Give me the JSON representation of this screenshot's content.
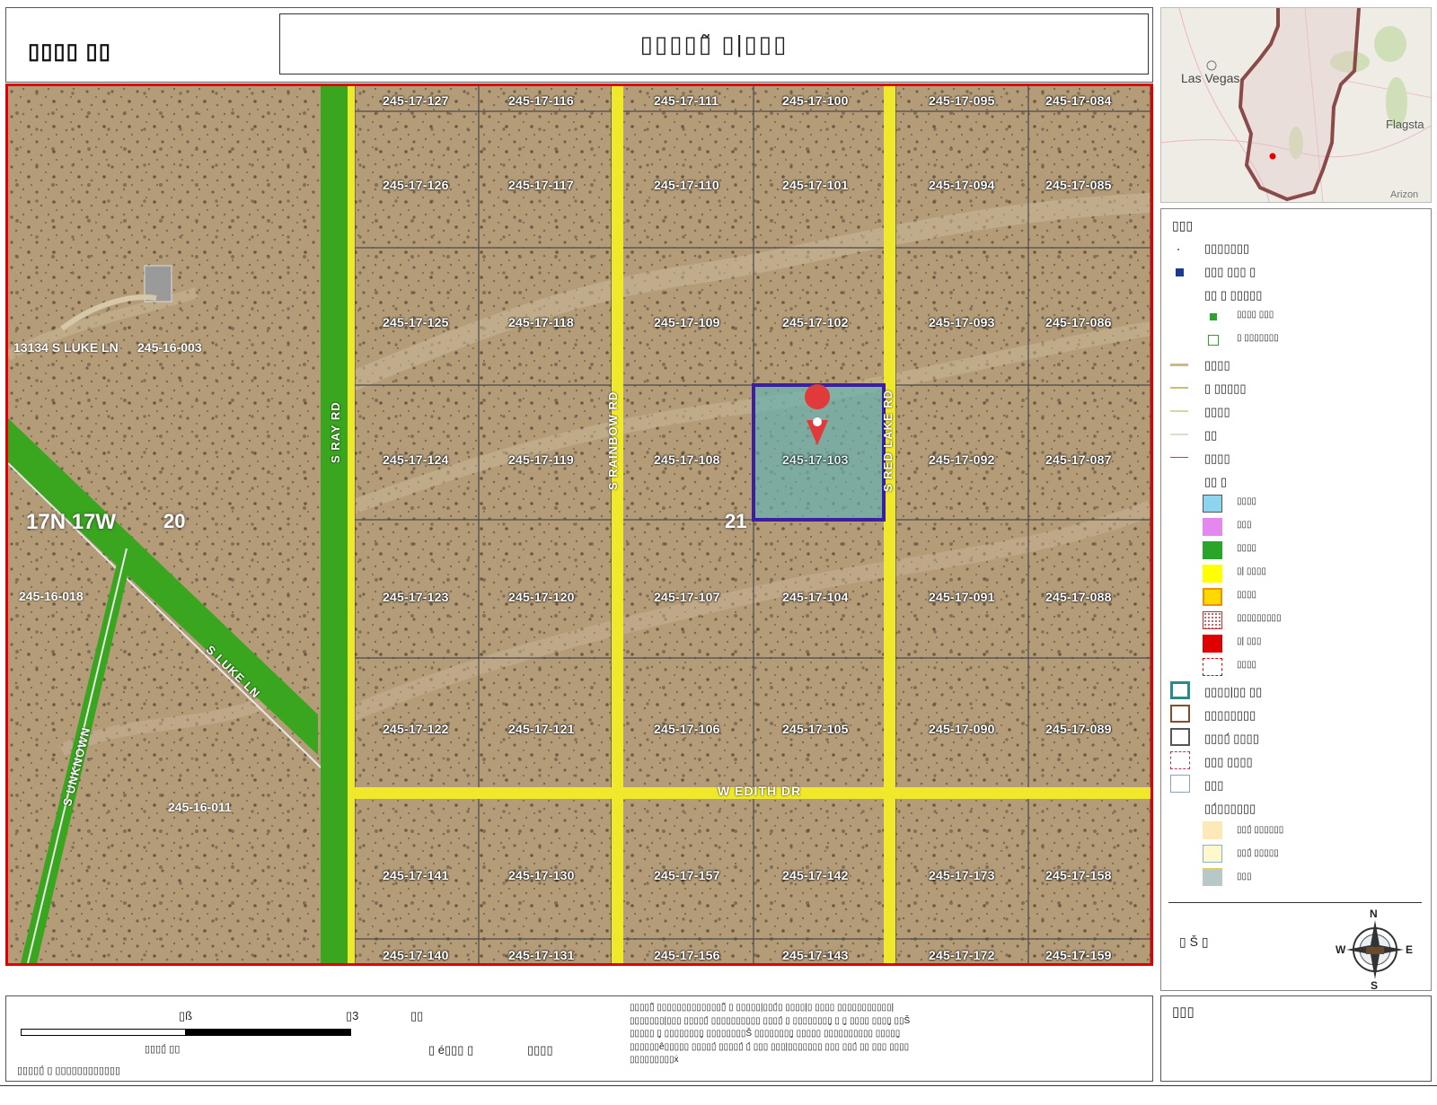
{
  "header": {
    "logo_text": "▯▯▯▯ ▯▯",
    "map_title": "▯▯▯▯▯̃ ▯|▯▯▯"
  },
  "inset": {
    "city_label": "Las Vegas",
    "east_label": "Flagsta",
    "south_label": "Arizon"
  },
  "map": {
    "parcels": [
      "245-17-127",
      "245-17-116",
      "245-17-111",
      "245-17-100",
      "245-17-095",
      "245-17-084",
      "245-17-126",
      "245-17-117",
      "245-17-110",
      "245-17-101",
      "245-17-094",
      "245-17-085",
      "245-17-125",
      "245-17-118",
      "245-17-109",
      "245-17-102",
      "245-17-093",
      "245-17-086",
      "245-17-124",
      "245-17-119",
      "245-17-108",
      "245-17-103",
      "245-17-092",
      "245-17-087",
      "245-17-123",
      "245-17-120",
      "245-17-107",
      "245-17-104",
      "245-17-091",
      "245-17-088",
      "245-17-122",
      "245-17-121",
      "245-17-106",
      "245-17-105",
      "245-17-090",
      "245-17-089",
      "245-17-141",
      "245-17-130",
      "245-17-157",
      "245-17-142",
      "245-17-173",
      "245-17-158",
      "245-17-140",
      "245-17-131",
      "245-17-156",
      "245-17-143",
      "245-17-172",
      "245-17-159"
    ],
    "west_labels": {
      "address": "13134 S LUKE LN",
      "parcel_a": "245-16-003",
      "parcel_b": "245-16-018",
      "parcel_c": "245-16-011",
      "township": "17N 17W",
      "section_20": "20",
      "section_21": "21"
    },
    "roads": {
      "ray": "S RAY RD",
      "rainbow": "S RAINBOW RD",
      "red_lake": "S RED LAKE RD",
      "edith": "W EDITH DR",
      "luke": "S LUKE LN",
      "unknown": "S UNKNOWN"
    },
    "selected_parcel": "245-17-103",
    "colors": {
      "highway_green": "#3aa51e",
      "road_yellow": "#f0e82a",
      "selection_border": "#3a1fa0",
      "selection_fill": "#5fb3b3",
      "frame_red": "#e00000"
    }
  },
  "legend": {
    "title": "▯▯▯",
    "items": [
      "▯▯▯▯▯▯▯",
      "▯▯▯ ▯▯▯ ▯",
      "▯▯ ▯ ▯▯▯▯▯",
      "▯▯▯▯ ▯▯▯",
      "▯ ▯▯▯▯▯▯▯",
      "▯▯▯▯",
      "▯ ▯▯▯▯▯",
      "▯▯▯▯",
      "▯▯",
      "▯▯▯▯",
      "▯▯ ▯",
      "▯▯▯▯",
      "▯▯▯",
      "▯▯▯▯",
      "▯| ▯▯▯▯",
      "▯▯▯▯",
      "▯▯▯▯▯▯▯▯▯",
      "▯| ▯▯▯",
      "▯▯▯▯",
      "▯▯▯▯|▯▯ ▯▯",
      "▯▯▯▯▯▯▯▯",
      "▯▯▯▯́ ▯▯▯▯",
      "▯▯▯ ▯▯▯▯",
      "▯▯▯",
      "▯▯́▯▯▯▯▯▯",
      "▯▯▯́ ▯▯▯▯▯▯",
      "▯▯▯́ ▯▯▯▯▯",
      "▯▯▯"
    ],
    "north_label": "▯ Š ▯",
    "compass": {
      "n": "N",
      "s": "S",
      "e": "E",
      "w": "W"
    }
  },
  "footer": {
    "scale_left": "▯ß",
    "scale_right": "▯3",
    "scale_unit": "▯▯",
    "scale_caption": "▯▯▯▯́ ▯▯",
    "projection": "▯▯▯▯▯́ ▯ ▯▯▯▯▯▯▯▯▯▯▯▯",
    "date_label": "▯ é▯▯▯ ▯",
    "date_value": "▯▯▯▯",
    "disclaimer": "▯▯▯▯▯̃ ▯▯▯▯▯▯▯▯▯▯▯▯▯▯̃ ▯ ▯▯▯▯▯|▯▯▯́▯ ▯▯▯▯|▯ ▯▯▯▯ ▯▯▯▯▯▯▯▯▯▯▯|▯▯▯▯▯▯▯|▯▯▯ ▯▯▯▯▯́ ▯▯▯▯▯▯▯▯▯▯ ▯▯▯▯́ ▯ ▯▯▯▯▯▯▯▯̧ ▯ ▯̧ ▯▯▯▯ ▯▯▯▯̧ ▯▯Š ▯▯▯▯▯ ▯̧ ▯▯▯▯▯▯▯▯̧ ▯▯▯▯▯▯▯▯Š ▯▯▯▯▯▯▯▯̧ ▯▯▯▯▯ ▯▯▯▯▯▯▯▯▯▯ ▯▯▯▯▯̧ ▯▯▯▯▯▯ê▯▯▯▯▯ ▯▯▯▯▯́ ▯▯▯▯▯́ ▯́ ▯▯▯ ▯▯▯|▯▯▯▯▯▯▯ ▯▯▯ ▯▯▯́ ▯▯ ▯▯▯ ▯▯▯▯ ▯▯▯▯▯▯▯▯▯ẋ"
  },
  "footer_right": {
    "label": "▯▯▯"
  }
}
